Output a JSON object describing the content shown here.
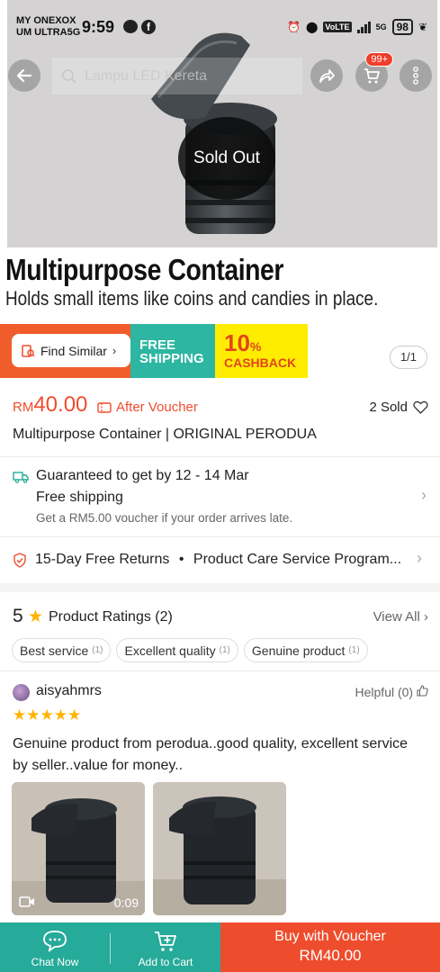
{
  "status_bar": {
    "carrier_line1": "MY ONEXOX",
    "carrier_line2": "UM ULTRA5G",
    "time": "9:59",
    "volte": "VoLTE",
    "network": "5G",
    "battery": "98"
  },
  "header": {
    "search_placeholder": "Lampu LED Kereta",
    "cart_badge": "99+"
  },
  "hero": {
    "sold_out_label": "Sold Out",
    "title": "Multipurpose Container",
    "subtitle": "Holds small items like coins and candies in place.",
    "find_similar_label": "Find Similar",
    "free_shipping_line1": "FREE",
    "free_shipping_line2": "SHIPPING",
    "cashback_value": "10",
    "cashback_percent": "%",
    "cashback_label": "CASHBACK",
    "page_indicator": "1/1"
  },
  "product": {
    "currency": "RM",
    "price": "40.00",
    "voucher_label": "After Voucher",
    "sold_count": "2 Sold",
    "name": "Multipurpose Container | ORIGINAL PERODUA"
  },
  "shipping": {
    "guarantee": "Guaranteed to get by 12 - 14 Mar",
    "free_shipping": "Free shipping",
    "late_voucher": "Get a RM5.00 voucher if your order arrives late."
  },
  "returns": {
    "text": "15-Day Free Returns",
    "separator": "•",
    "program": "Product Care Service Program..."
  },
  "ratings": {
    "score": "5",
    "title": "Product Ratings",
    "count": "(2)",
    "view_all": "View All",
    "tags": [
      {
        "label": "Best service",
        "count": "(1)"
      },
      {
        "label": "Excellent quality",
        "count": "(1)"
      },
      {
        "label": "Genuine product",
        "count": "(1)"
      }
    ]
  },
  "review": {
    "username": "aisyahmrs",
    "helpful": "Helpful (0)",
    "stars": "★★★★★",
    "rating": 5,
    "text": "Genuine product from perodua..good quality, excellent service by seller..value for money..",
    "video_duration": "0:09"
  },
  "bottom_bar": {
    "chat_label": "Chat Now",
    "cart_label": "Add to Cart",
    "buy_label": "Buy with Voucher",
    "buy_price": "RM40.00"
  },
  "colors": {
    "brand_orange": "#ee4d2d",
    "teal": "#26aa99",
    "star": "#ffb400"
  }
}
